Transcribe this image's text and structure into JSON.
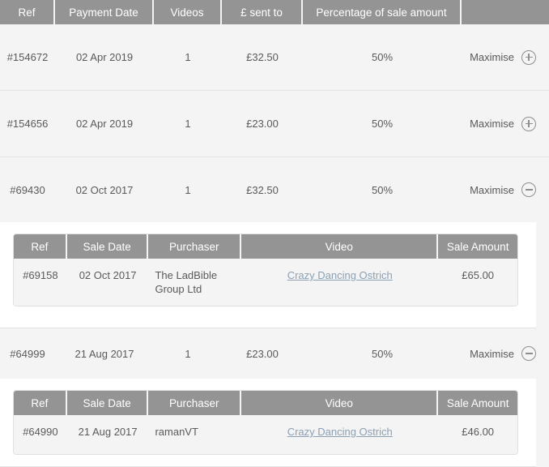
{
  "main_table": {
    "columns": [
      "Ref",
      "Payment Date",
      "Videos",
      "£ sent to",
      "Percentage of sale amount",
      ""
    ],
    "rows": [
      {
        "ref": "#154672",
        "payment_date": "02 Apr 2019",
        "videos": "1",
        "sent_to": "£32.50",
        "percentage": "50%",
        "action_label": "Maximise",
        "action_icon": "plus-circle-icon",
        "expanded": false
      },
      {
        "ref": "#154656",
        "payment_date": "02 Apr 2019",
        "videos": "1",
        "sent_to": "£23.00",
        "percentage": "50%",
        "action_label": "Maximise",
        "action_icon": "plus-circle-icon",
        "expanded": false
      },
      {
        "ref": "#69430",
        "payment_date": "02 Oct 2017",
        "videos": "1",
        "sent_to": "£32.50",
        "percentage": "50%",
        "action_label": "Maximise",
        "action_icon": "minus-circle-icon",
        "expanded": true
      },
      {
        "ref": "#64999",
        "payment_date": "21 Aug 2017",
        "videos": "1",
        "sent_to": "£23.00",
        "percentage": "50%",
        "action_label": "Maximise",
        "action_icon": "minus-circle-icon",
        "expanded": true
      }
    ]
  },
  "sub_table": {
    "columns": [
      "Ref",
      "Sale Date",
      "Purchaser",
      "Video",
      "Sale Amount"
    ],
    "details": [
      {
        "ref": "#69158",
        "sale_date": "02 Oct 2017",
        "purchaser": "The LadBible Group Ltd",
        "video": "Crazy Dancing Ostrich",
        "sale_amount": "£65.00"
      },
      {
        "ref": "#64990",
        "sale_date": "21 Aug 2017",
        "purchaser": "ramanVT",
        "video": "Crazy Dancing Ostrich",
        "sale_amount": "£46.00"
      }
    ]
  },
  "colors": {
    "header_gray": "#949494",
    "page_bg": "#f4f4f4",
    "row_divider": "#e3e3e3",
    "link": "#8ca0b3",
    "text": "#5a5a5a",
    "panel_bg": "#ffffff"
  }
}
